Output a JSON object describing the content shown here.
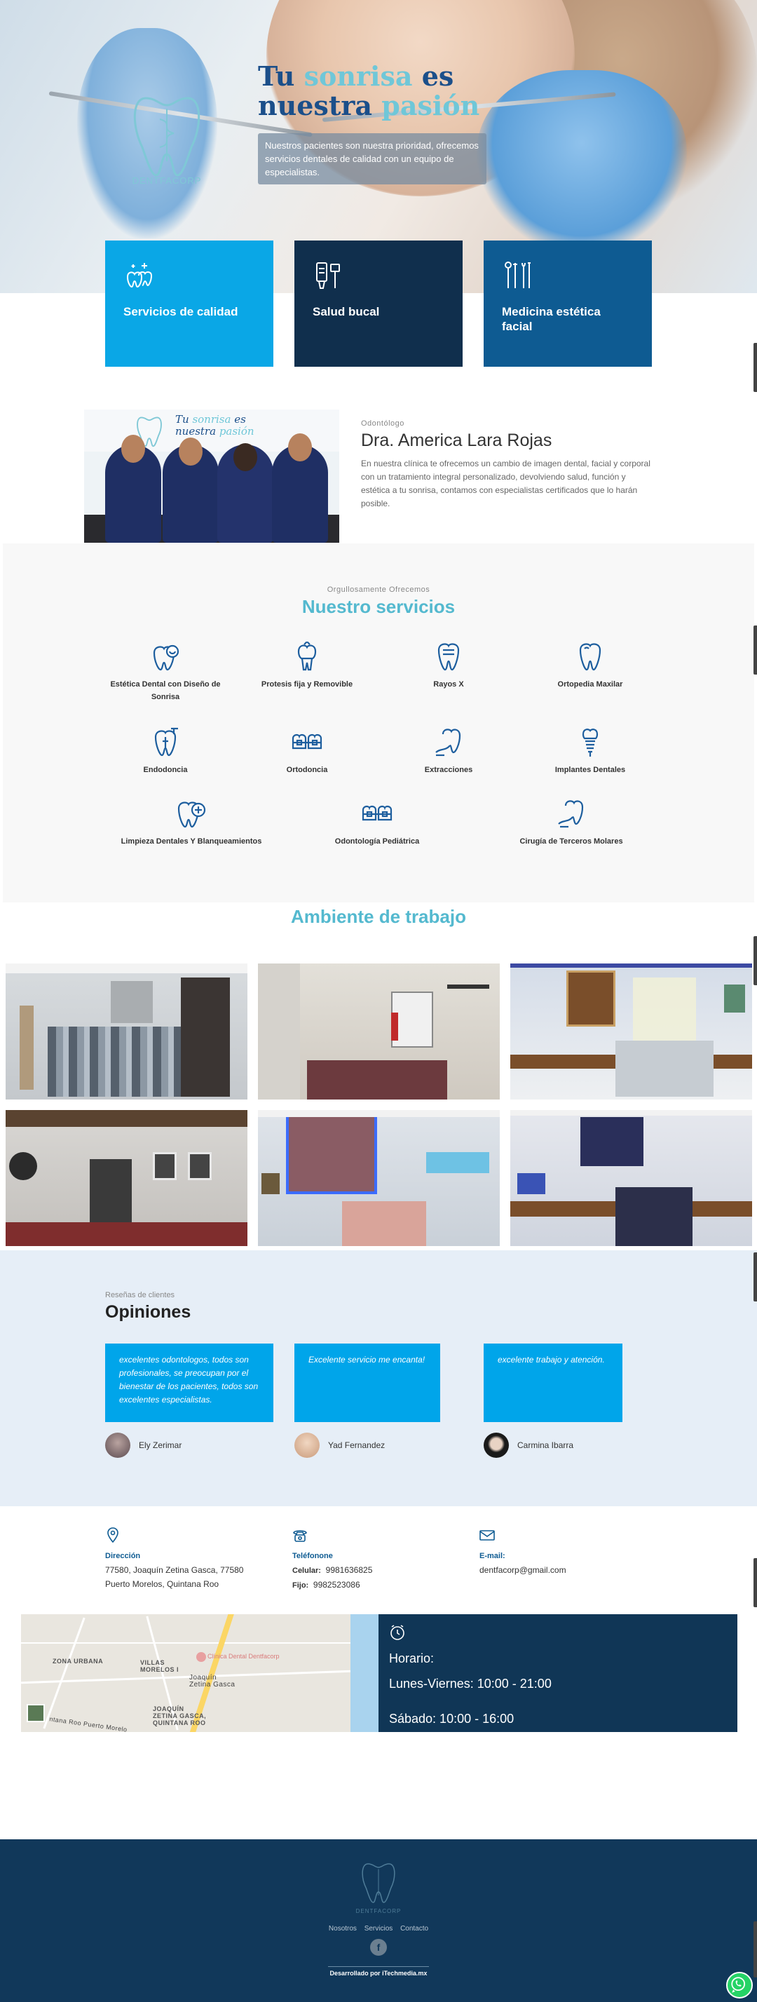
{
  "hero": {
    "title_line1_a": "Tu ",
    "title_line1_b": "sonrisa",
    "title_line1_c": " es",
    "title_line2_a": "nuestra ",
    "title_line2_b": "pasión",
    "intro": "Nuestros pacientes son nuestra prioridad, ofrecemos servicios dentales de calidad con un equipo de especialistas.",
    "logo_text": "DENTFACORP"
  },
  "cards": [
    {
      "label": "Servicios de calidad",
      "icon": "teeth-sparkle-icon",
      "color": "#0aa7e6"
    },
    {
      "label": "Salud bucal",
      "icon": "toothpaste-icon",
      "color": "#102f4d"
    },
    {
      "label": "Medicina estética facial",
      "icon": "dental-tools-icon",
      "color": "#0e5b92"
    }
  ],
  "doctor": {
    "subtitle": "Odontólogo",
    "name": "Dra. America Lara Rojas",
    "description": "En nuestra clínica te ofrecemos un cambio de imagen dental, facial y corporal con un tratamiento integral personalizado, devolviendo salud, función y estética a tu sonrisa, contamos con especialistas certificados que lo harán posible."
  },
  "services": {
    "subtitle": "Orgullosamente Ofrecemos",
    "title": "Nuestro servicios",
    "items": [
      {
        "label": "Estética Dental con Diseño de Sonrisa",
        "icon": "tooth-smile-icon"
      },
      {
        "label": "Protesis fija y Removible",
        "icon": "tooth-prosthesis-icon"
      },
      {
        "label": "Rayos X",
        "icon": "tooth-xray-icon"
      },
      {
        "label": "Ortopedia Maxilar",
        "icon": "tooth-icon"
      },
      {
        "label": "Endodoncia",
        "icon": "tooth-root-icon"
      },
      {
        "label": "Ortodoncia",
        "icon": "braces-icon"
      },
      {
        "label": "Extracciones",
        "icon": "tooth-extraction-icon"
      },
      {
        "label": "Implantes Dentales",
        "icon": "dental-implant-icon"
      },
      {
        "label": "Limpieza Dentales Y Blanqueamientos",
        "icon": "tooth-cleaning-icon"
      },
      {
        "label": "Odontología Pediátrica",
        "icon": "kids-braces-icon"
      },
      {
        "label": "Cirugía de Terceros Molares",
        "icon": "molar-surgery-icon"
      }
    ]
  },
  "ambiente": {
    "title": "Ambiente de trabajo"
  },
  "reviews": {
    "subtitle": "Reseñas de clientes",
    "title": "Opiniones",
    "items": [
      {
        "quote": "excelentes odontologos, todos son profesionales, se preocupan por el bienestar de los pacientes, todos son excelentes especialistas.",
        "name": "Ely Zerimar"
      },
      {
        "quote": "Excelente servicio me encanta!",
        "name": "Yad Fernandez"
      },
      {
        "quote": "excelente trabajo y atención.",
        "name": "Carmina Ibarra"
      }
    ]
  },
  "contact": {
    "address_label": "Dirección",
    "address_line1": "77580, Joaquín Zetina Gasca, 77580",
    "address_line2": "Puerto Morelos, Quintana Roo",
    "phone_label": "Teléfonone",
    "cell_label": "Celular:",
    "cell": "9981636825",
    "fixed_label": "Fijo:",
    "fixed": "9982523086",
    "email_label": "E-mail:",
    "email": "dentfacorp@gmail.com"
  },
  "map": {
    "label_zona": "ZONA URBANA",
    "label_villas": "VILLAS\nMORELOS I",
    "label_joaquin": "Joaquín\nZetina Gasca",
    "label_joaquin2": "JOAQUÍN\nZETINA GASCA,\nQUINTANA ROO",
    "label_pin": "Clínica Dental Dentfacorp",
    "label_road": "ntana Roo Puerto Morelo"
  },
  "hours": {
    "title": "Horario:",
    "weekdays": "Lunes-Viernes: 10:00 - 21:00",
    "saturday": "Sábado: 10:00 - 16:00"
  },
  "footer": {
    "logo_text": "DENTFACORP",
    "nav": [
      "Nosotros",
      "Servicios",
      "Contacto"
    ],
    "facebook": "f",
    "credit": "Desarrollado por iTechmedia.mx"
  },
  "colors": {
    "accent": "#54b9cf",
    "primary_blue": "#0aa7e6",
    "navy": "#102f4d",
    "mid_blue": "#0e5b92",
    "icon_blue": "#1d5e9e"
  }
}
